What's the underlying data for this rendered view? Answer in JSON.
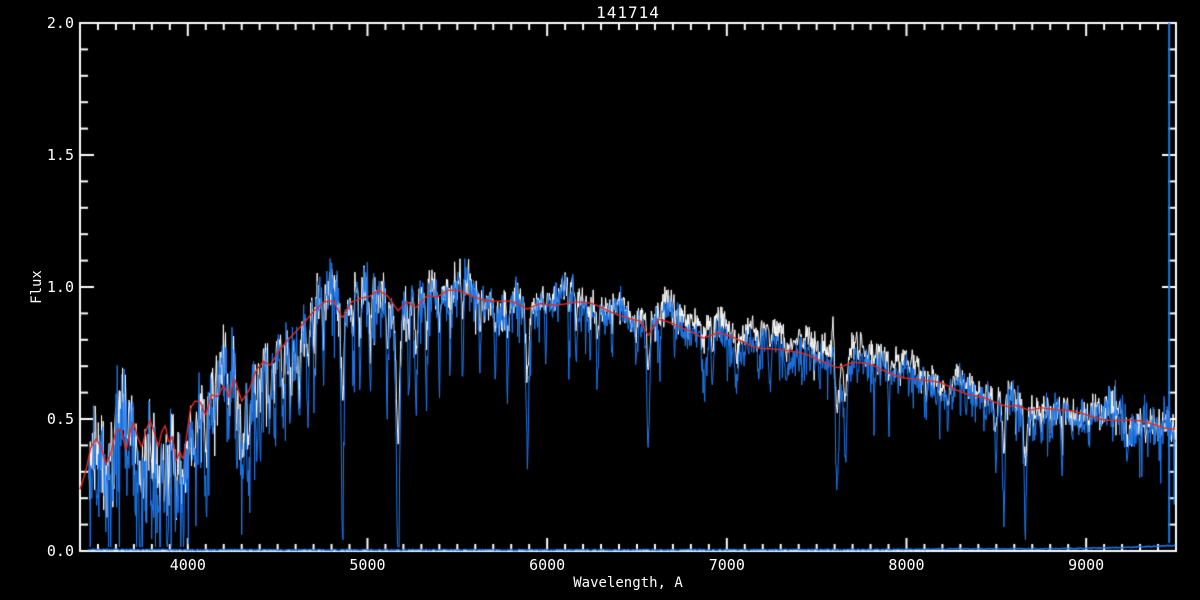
{
  "chart_data": {
    "type": "line",
    "title": "141714",
    "xlabel": "Wavelength, A",
    "ylabel": "Flux",
    "xlim": [
      3400,
      9500
    ],
    "ylim": [
      0.0,
      2.0
    ],
    "grid": false,
    "legend": "none",
    "x_ticks": [
      {
        "value": 4000,
        "label": "4000"
      },
      {
        "value": 5000,
        "label": "5000"
      },
      {
        "value": 6000,
        "label": "6000"
      },
      {
        "value": 7000,
        "label": "7000"
      },
      {
        "value": 8000,
        "label": "8000"
      },
      {
        "value": 9000,
        "label": "9000"
      }
    ],
    "x_minor_step": 100,
    "y_ticks": [
      {
        "value": 0.0,
        "label": "0.0"
      },
      {
        "value": 0.5,
        "label": "0.5"
      },
      {
        "value": 1.0,
        "label": "1.0"
      },
      {
        "value": 1.5,
        "label": "1.5"
      },
      {
        "value": 2.0,
        "label": "2.0"
      }
    ],
    "y_minor_step": 0.1,
    "colors": {
      "background": "#000000",
      "axis": "#ffffff",
      "observed": "#ffffff",
      "observed_blue": "#1e78ec",
      "model": "#df2b28"
    },
    "series": [
      {
        "name": "observed spectrum",
        "style": "noisy-line",
        "color_key": "observed"
      },
      {
        "name": "observed spectrum (fit region)",
        "style": "noisy-line",
        "color_key": "observed_blue"
      },
      {
        "name": "best-fit model spectrum",
        "style": "smooth-line",
        "color_key": "model"
      },
      {
        "name": "error spectrum",
        "style": "line-near-zero",
        "color_key": "observed_blue"
      }
    ],
    "continuum": [
      [
        3400,
        0.24
      ],
      [
        3430,
        0.3
      ],
      [
        3460,
        0.39
      ],
      [
        3490,
        0.42
      ],
      [
        3520,
        0.38
      ],
      [
        3545,
        0.32
      ],
      [
        3570,
        0.36
      ],
      [
        3600,
        0.45
      ],
      [
        3630,
        0.46
      ],
      [
        3655,
        0.38
      ],
      [
        3680,
        0.46
      ],
      [
        3700,
        0.49
      ],
      [
        3720,
        0.44
      ],
      [
        3745,
        0.4
      ],
      [
        3765,
        0.46
      ],
      [
        3790,
        0.5
      ],
      [
        3815,
        0.45
      ],
      [
        3835,
        0.39
      ],
      [
        3855,
        0.45
      ],
      [
        3875,
        0.47
      ],
      [
        3895,
        0.4
      ],
      [
        3915,
        0.43
      ],
      [
        3935,
        0.33
      ],
      [
        3955,
        0.37
      ],
      [
        3975,
        0.34
      ],
      [
        3995,
        0.44
      ],
      [
        4015,
        0.54
      ],
      [
        4040,
        0.57
      ],
      [
        4070,
        0.57
      ],
      [
        4100,
        0.52
      ],
      [
        4130,
        0.6
      ],
      [
        4165,
        0.59
      ],
      [
        4200,
        0.63
      ],
      [
        4230,
        0.58
      ],
      [
        4260,
        0.65
      ],
      [
        4300,
        0.56
      ],
      [
        4340,
        0.6
      ],
      [
        4380,
        0.68
      ],
      [
        4420,
        0.72
      ],
      [
        4460,
        0.71
      ],
      [
        4500,
        0.76
      ],
      [
        4550,
        0.8
      ],
      [
        4600,
        0.83
      ],
      [
        4650,
        0.86
      ],
      [
        4700,
        0.9
      ],
      [
        4760,
        0.94
      ],
      [
        4810,
        0.95
      ],
      [
        4861,
        0.89
      ],
      [
        4910,
        0.95
      ],
      [
        4960,
        0.96
      ],
      [
        5010,
        0.96
      ],
      [
        5060,
        0.98
      ],
      [
        5110,
        0.96
      ],
      [
        5170,
        0.91
      ],
      [
        5220,
        0.95
      ],
      [
        5270,
        0.93
      ],
      [
        5330,
        0.97
      ],
      [
        5390,
        0.96
      ],
      [
        5450,
        0.98
      ],
      [
        5510,
        0.98
      ],
      [
        5570,
        0.97
      ],
      [
        5640,
        0.96
      ],
      [
        5720,
        0.95
      ],
      [
        5800,
        0.94
      ],
      [
        5890,
        0.91
      ],
      [
        5960,
        0.94
      ],
      [
        6050,
        0.94
      ],
      [
        6150,
        0.94
      ],
      [
        6250,
        0.93
      ],
      [
        6350,
        0.91
      ],
      [
        6450,
        0.89
      ],
      [
        6520,
        0.87
      ],
      [
        6563,
        0.81
      ],
      [
        6620,
        0.87
      ],
      [
        6700,
        0.86
      ],
      [
        6800,
        0.84
      ],
      [
        6870,
        0.81
      ],
      [
        6950,
        0.82
      ],
      [
        7050,
        0.8
      ],
      [
        7150,
        0.78
      ],
      [
        7250,
        0.77
      ],
      [
        7350,
        0.75
      ],
      [
        7450,
        0.74
      ],
      [
        7550,
        0.72
      ],
      [
        7620,
        0.7
      ],
      [
        7700,
        0.71
      ],
      [
        7800,
        0.7
      ],
      [
        7900,
        0.68
      ],
      [
        8000,
        0.66
      ],
      [
        8100,
        0.64
      ],
      [
        8200,
        0.63
      ],
      [
        8300,
        0.61
      ],
      [
        8400,
        0.59
      ],
      [
        8460,
        0.57
      ],
      [
        8510,
        0.55
      ],
      [
        8560,
        0.54
      ],
      [
        8620,
        0.55
      ],
      [
        8680,
        0.54
      ],
      [
        8750,
        0.55
      ],
      [
        8850,
        0.53
      ],
      [
        8950,
        0.52
      ],
      [
        9050,
        0.51
      ],
      [
        9150,
        0.5
      ],
      [
        9250,
        0.49
      ],
      [
        9350,
        0.48
      ],
      [
        9450,
        0.47
      ],
      [
        9500,
        0.47
      ]
    ],
    "absorption_lines": [
      [
        3498,
        0.25,
        7
      ],
      [
        3550,
        0.18,
        8
      ],
      [
        3585,
        0.22,
        7
      ],
      [
        3620,
        0.28,
        6
      ],
      [
        3665,
        0.24,
        7
      ],
      [
        3705,
        0.19,
        8
      ],
      [
        3735,
        0.16,
        8
      ],
      [
        3770,
        0.21,
        7
      ],
      [
        3798,
        0.17,
        7
      ],
      [
        3835,
        0.15,
        8
      ],
      [
        3870,
        0.24,
        6
      ],
      [
        3890,
        0.14,
        8
      ],
      [
        3935,
        0.12,
        9
      ],
      [
        3970,
        0.13,
        9
      ],
      [
        4045,
        0.34,
        6
      ],
      [
        4101,
        0.24,
        9
      ],
      [
        4144,
        0.4,
        6
      ],
      [
        4227,
        0.3,
        7
      ],
      [
        4272,
        0.36,
        6
      ],
      [
        4305,
        0.26,
        9
      ],
      [
        4340,
        0.28,
        8
      ],
      [
        4383,
        0.33,
        7
      ],
      [
        4405,
        0.42,
        6
      ],
      [
        4455,
        0.46,
        6
      ],
      [
        4481,
        0.5,
        5
      ],
      [
        4528,
        0.48,
        6
      ],
      [
        4570,
        0.55,
        5
      ],
      [
        4620,
        0.52,
        5
      ],
      [
        4668,
        0.46,
        6
      ],
      [
        4703,
        0.55,
        5
      ],
      [
        4755,
        0.6,
        5
      ],
      [
        4861,
        0.14,
        7
      ],
      [
        4920,
        0.62,
        5
      ],
      [
        4957,
        0.6,
        5
      ],
      [
        5015,
        0.55,
        6
      ],
      [
        5110,
        0.57,
        5
      ],
      [
        5170,
        0.08,
        9
      ],
      [
        5230,
        0.58,
        6
      ],
      [
        5270,
        0.47,
        7
      ],
      [
        5328,
        0.6,
        5
      ],
      [
        5400,
        0.64,
        5
      ],
      [
        5460,
        0.68,
        4
      ],
      [
        5530,
        0.66,
        5
      ],
      [
        5625,
        0.7,
        4
      ],
      [
        5711,
        0.7,
        4
      ],
      [
        5782,
        0.72,
        4
      ],
      [
        5890,
        0.34,
        8
      ],
      [
        5990,
        0.75,
        4
      ],
      [
        6122,
        0.68,
        5
      ],
      [
        6162,
        0.7,
        5
      ],
      [
        6240,
        0.74,
        4
      ],
      [
        6280,
        0.66,
        6
      ],
      [
        6360,
        0.73,
        4
      ],
      [
        6495,
        0.72,
        4
      ],
      [
        6563,
        0.38,
        7
      ],
      [
        6625,
        0.74,
        4
      ],
      [
        6710,
        0.71,
        4
      ],
      [
        6870,
        0.63,
        9
      ],
      [
        6920,
        0.62,
        5
      ],
      [
        7055,
        0.65,
        5
      ],
      [
        7180,
        0.63,
        6
      ],
      [
        7240,
        0.59,
        6
      ],
      [
        7330,
        0.65,
        5
      ],
      [
        7420,
        0.66,
        4
      ],
      [
        7515,
        0.64,
        4
      ],
      [
        7615,
        0.33,
        10
      ],
      [
        7660,
        0.4,
        9
      ],
      [
        7730,
        0.62,
        4
      ],
      [
        7820,
        0.6,
        4
      ],
      [
        7905,
        0.58,
        4
      ],
      [
        8015,
        0.55,
        4
      ],
      [
        8110,
        0.54,
        4
      ],
      [
        8230,
        0.51,
        5
      ],
      [
        8330,
        0.5,
        4
      ],
      [
        8434,
        0.47,
        5
      ],
      [
        8498,
        0.3,
        6
      ],
      [
        8542,
        0.09,
        7
      ],
      [
        8610,
        0.44,
        5
      ],
      [
        8662,
        0.11,
        7
      ],
      [
        8710,
        0.45,
        4
      ],
      [
        8750,
        0.41,
        5
      ],
      [
        8807,
        0.42,
        4
      ],
      [
        8865,
        0.28,
        6
      ],
      [
        8920,
        0.42,
        4
      ],
      [
        9015,
        0.38,
        5
      ],
      [
        9080,
        0.42,
        4
      ],
      [
        9150,
        0.4,
        4
      ],
      [
        9230,
        0.36,
        5
      ],
      [
        9310,
        0.4,
        4
      ],
      [
        9410,
        0.38,
        4
      ]
    ],
    "emission_spike": {
      "center": 7592,
      "amplitude": 0.13,
      "width": 6
    },
    "right_edge_spike": {
      "wavelength": 9462,
      "flux_bottom": 0.03,
      "flux_top": 2.0
    },
    "error_level": [
      [
        3450,
        0.006
      ],
      [
        4000,
        0.004
      ],
      [
        6000,
        0.004
      ],
      [
        7800,
        0.005
      ],
      [
        8300,
        0.008
      ],
      [
        8700,
        0.008
      ],
      [
        9000,
        0.01
      ],
      [
        9250,
        0.014
      ],
      [
        9400,
        0.018
      ],
      [
        9500,
        0.022
      ]
    ],
    "noise_sigma": [
      [
        3400,
        0.1
      ],
      [
        3600,
        0.1
      ],
      [
        3900,
        0.09
      ],
      [
        4100,
        0.075
      ],
      [
        4400,
        0.065
      ],
      [
        4700,
        0.055
      ],
      [
        5000,
        0.05
      ],
      [
        5400,
        0.045
      ],
      [
        5800,
        0.04
      ],
      [
        6300,
        0.035
      ],
      [
        6800,
        0.032
      ],
      [
        7300,
        0.03
      ],
      [
        7800,
        0.03
      ],
      [
        8300,
        0.03
      ],
      [
        8800,
        0.035
      ],
      [
        9200,
        0.04
      ],
      [
        9500,
        0.045
      ]
    ],
    "white_offset": [
      [
        3400,
        0.0
      ],
      [
        5800,
        0.005
      ],
      [
        6400,
        0.03
      ],
      [
        6800,
        0.05
      ],
      [
        7300,
        0.055
      ],
      [
        7700,
        0.05
      ],
      [
        8100,
        0.035
      ],
      [
        8500,
        0.015
      ],
      [
        8800,
        0.01
      ],
      [
        9500,
        0.01
      ]
    ],
    "noise_seed": 11,
    "sample_step_angstrom": 3,
    "data_start": 3448,
    "data_end": 9497
  }
}
